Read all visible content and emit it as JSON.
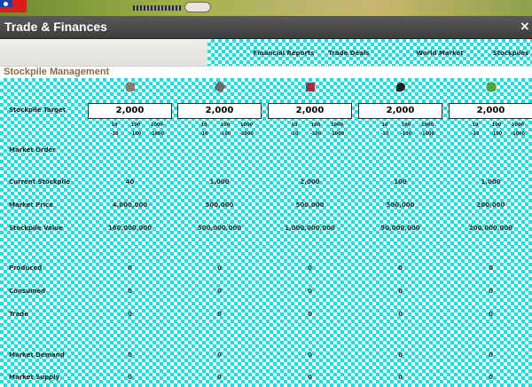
{
  "window": {
    "title": "Trade & Finances",
    "close_glyph": "×"
  },
  "tabs": [
    {
      "label": "Financial Reports"
    },
    {
      "label": "Trade Deals"
    },
    {
      "label": "World Market"
    },
    {
      "label": "Stockpiles"
    }
  ],
  "section_title": "Stockpile Management",
  "resources": [
    {
      "icon": "lumber-icon",
      "color": "#8a7a6a"
    },
    {
      "icon": "iron-icon",
      "color": "#6a6a6a"
    },
    {
      "icon": "coal-icon",
      "color": "#a03040"
    },
    {
      "icon": "oil-icon",
      "color": "#202020"
    },
    {
      "icon": "food-icon",
      "color": "#5aa040"
    }
  ],
  "rows": {
    "stockpile_target": "Stockpile Target",
    "market_order": "Market Order",
    "current_stockpile": "Current Stockpile",
    "market_price": "Market Price",
    "stockpile_value": "Stockpile Value",
    "produced": "Produced",
    "consumed": "Consumed",
    "trade": "Trade",
    "market_demand": "Market Demand",
    "market_supply": "Market Supply"
  },
  "targets": [
    "2,000",
    "2,000",
    "2,000",
    "2,000",
    "2,000"
  ],
  "steps_up": [
    "10",
    "100",
    "1000"
  ],
  "steps_down": [
    "-10",
    "-100",
    "-1000"
  ],
  "current_stockpile": [
    "40",
    "1,000",
    "2,000",
    "100",
    "1,000"
  ],
  "market_price": [
    "4,000,000",
    "500,000",
    "500,000",
    "500,000",
    "200,000"
  ],
  "stockpile_value": [
    "160,000,000",
    "500,000,000",
    "1,000,000,000",
    "50,000,000",
    "200,000,000"
  ],
  "produced": [
    "0",
    "0",
    "0",
    "0",
    "0"
  ],
  "consumed": [
    "0",
    "0",
    "0",
    "0",
    "0"
  ],
  "trade": [
    "0",
    "0",
    "0",
    "0",
    "0"
  ],
  "market_demand": [
    "0",
    "0",
    "0",
    "0",
    "0"
  ],
  "market_supply": [
    "0",
    "0",
    "0",
    "0",
    "0"
  ]
}
